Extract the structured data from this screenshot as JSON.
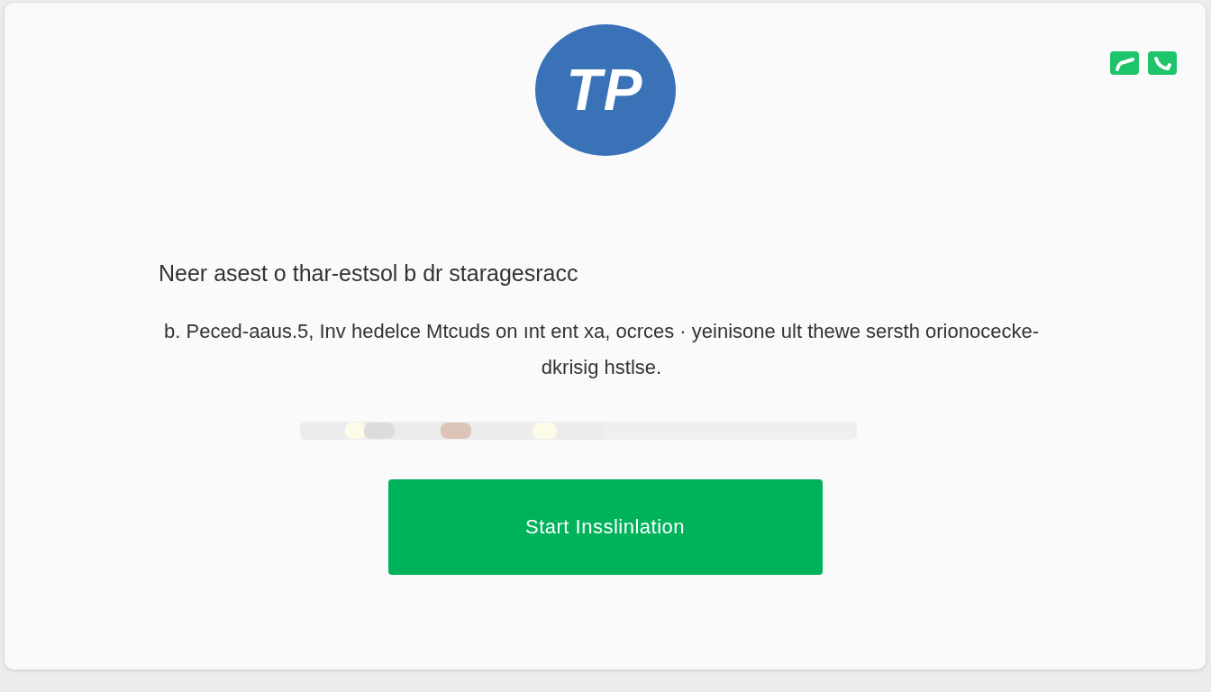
{
  "logo": {
    "text": "TP"
  },
  "heading": "Neer asest o thar-estsol b dr staragesracc",
  "description": "b. Peced-aaus.5, Inv hedelce Mtcuds on ınt ent xa, ocrces · yeinisone ult thewe sersth orionocecke-dkrisig hstlse.",
  "progress": {
    "level": 0.55
  },
  "button": {
    "label": "Start Insslinlation"
  }
}
